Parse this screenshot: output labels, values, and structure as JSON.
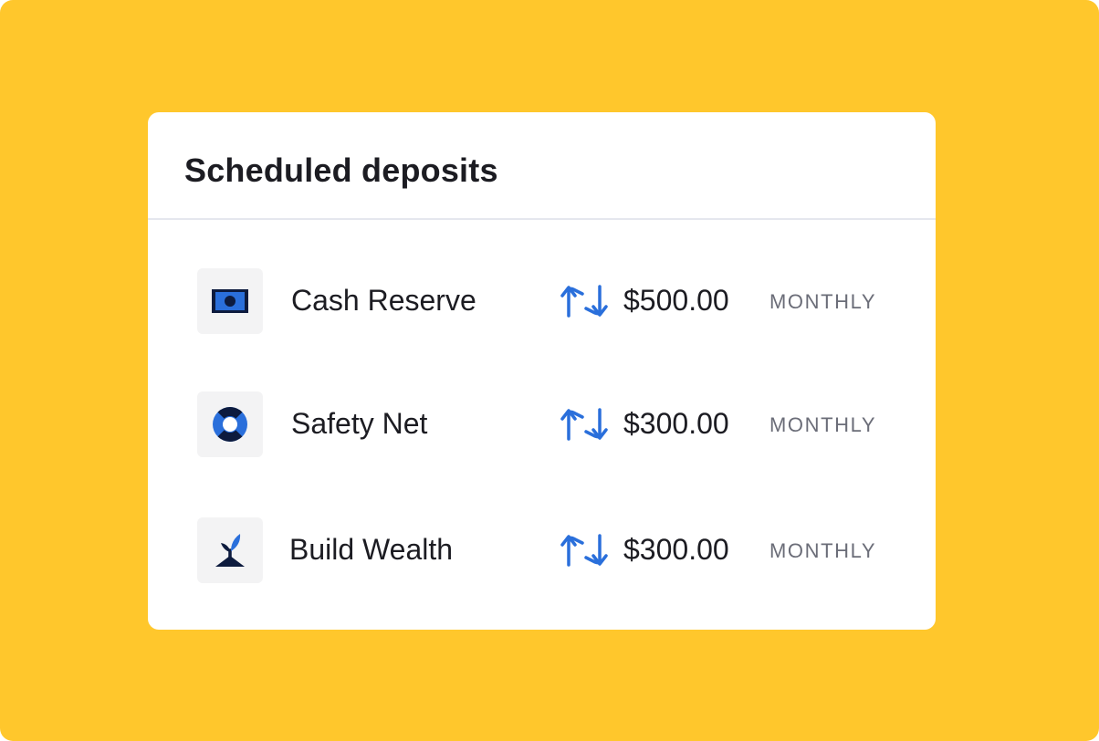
{
  "panel": {
    "title": "Scheduled deposits"
  },
  "deposits": [
    {
      "name": "Cash Reserve",
      "icon": "cash-bill-icon",
      "amount": "$500.00",
      "frequency": "MONTHLY"
    },
    {
      "name": "Safety Net",
      "icon": "life-ring-icon",
      "amount": "$300.00",
      "frequency": "MONTHLY"
    },
    {
      "name": "Build Wealth",
      "icon": "sprout-icon",
      "amount": "$300.00",
      "frequency": "MONTHLY"
    }
  ],
  "recurring_icon": "recurring-arrows-icon",
  "colors": {
    "background": "#FFC72C",
    "card": "#FFFFFF",
    "accent_blue": "#2A6FDB",
    "navy": "#0D1B3E",
    "text": "#1C1C22",
    "muted_text": "#6B6D78",
    "icon_tile": "#F3F3F4"
  }
}
